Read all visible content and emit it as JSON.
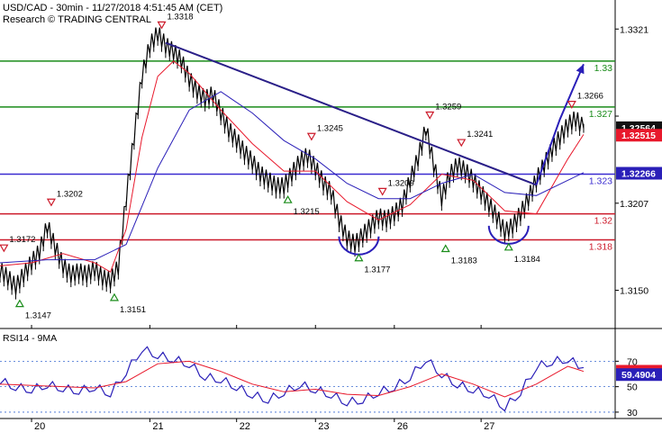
{
  "header": {
    "line1": "USD/CAD - 30min - 11/27/2018 4:51:45 AM (CET)",
    "line2": "Research © TRADING CENTRAL"
  },
  "chart_data": [
    {
      "type": "line",
      "title": "USD/CAD - 30min",
      "ylim": [
        1.3125,
        1.334
      ],
      "x_dates": [
        "20",
        "21",
        "22",
        "23",
        "26",
        "27"
      ],
      "price_ticks": [
        1.3321,
        1.3264,
        1.3207,
        1.315
      ],
      "price_tick_labels": [
        "1.3321",
        "",
        "1.3207",
        "1.3150"
      ],
      "hlines": [
        {
          "label": "1.33",
          "value": 1.33,
          "color": "#1a8c1a"
        },
        {
          "label": "1.327",
          "value": 1.327,
          "color": "#1a8c1a"
        },
        {
          "label": "1.323",
          "value": 1.3226,
          "color": "#3a2bd0"
        },
        {
          "label": "1.32",
          "value": 1.32,
          "color": "#cc1a2a"
        },
        {
          "label": "1.318",
          "value": 1.3183,
          "color": "#cc1a2a"
        }
      ],
      "last_price": {
        "label": "1.32564",
        "value": 1.32564,
        "color": "#111111"
      },
      "ma_fast": {
        "label": "1.32515",
        "value": 1.32515,
        "color": "#e8192c"
      },
      "ma_slow": {
        "label": "1.32266",
        "value": 1.32266,
        "color": "#2a1fb8"
      },
      "pivots": [
        {
          "label": "1.3172",
          "x": 0.5,
          "value": 1.3172,
          "kind": "high"
        },
        {
          "label": "1.3147",
          "x": 2.5,
          "value": 1.3147,
          "kind": "low"
        },
        {
          "label": "1.3202",
          "x": 6.5,
          "value": 1.3202,
          "kind": "high"
        },
        {
          "label": "1.3151",
          "x": 14.5,
          "value": 1.3151,
          "kind": "low"
        },
        {
          "label": "1.3318",
          "x": 20.5,
          "value": 1.3318,
          "kind": "high"
        },
        {
          "label": "1.3215",
          "x": 36.5,
          "value": 1.3215,
          "kind": "low"
        },
        {
          "label": "1.3245",
          "x": 39.5,
          "value": 1.3245,
          "kind": "high"
        },
        {
          "label": "1.3177",
          "x": 45.5,
          "value": 1.3177,
          "kind": "low"
        },
        {
          "label": "1.3209",
          "x": 48.5,
          "value": 1.3209,
          "kind": "high"
        },
        {
          "label": "1.3259",
          "x": 54.5,
          "value": 1.3259,
          "kind": "high"
        },
        {
          "label": "1.3183",
          "x": 56.5,
          "value": 1.3183,
          "kind": "low"
        },
        {
          "label": "1.3241",
          "x": 58.5,
          "value": 1.3241,
          "kind": "high"
        },
        {
          "label": "1.3184",
          "x": 64.5,
          "value": 1.3184,
          "kind": "low"
        },
        {
          "label": "1.3266",
          "x": 72.5,
          "value": 1.3266,
          "kind": "high"
        }
      ],
      "series": [
        {
          "name": "",
          "color": "#000000",
          "x": [
            0,
            1,
            2,
            3,
            4,
            5,
            6,
            7,
            8,
            9,
            10,
            11,
            12,
            13,
            14,
            15,
            16,
            17,
            18,
            19,
            20,
            21,
            22,
            23,
            24,
            25,
            26,
            27,
            28,
            29,
            30,
            31,
            32,
            33,
            34,
            35,
            36,
            37,
            38,
            39,
            40,
            41,
            42,
            43,
            44,
            45,
            46,
            47,
            48,
            49,
            50,
            51,
            52,
            53,
            54,
            55,
            56,
            57,
            58,
            59,
            60,
            61,
            62,
            63,
            64,
            65,
            66,
            67,
            68,
            69,
            70,
            71,
            72,
            73,
            74
          ],
          "values": [
            1.3163,
            1.3158,
            1.3152,
            1.316,
            1.3168,
            1.3175,
            1.3192,
            1.3178,
            1.3166,
            1.316,
            1.3162,
            1.316,
            1.3164,
            1.3158,
            1.3156,
            1.3165,
            1.321,
            1.325,
            1.329,
            1.331,
            1.3318,
            1.331,
            1.3306,
            1.33,
            1.3288,
            1.328,
            1.3275,
            1.3278,
            1.3266,
            1.3255,
            1.3248,
            1.324,
            1.3234,
            1.3226,
            1.3222,
            1.3218,
            1.3218,
            1.3226,
            1.3234,
            1.3238,
            1.323,
            1.322,
            1.3214,
            1.3196,
            1.3184,
            1.318,
            1.3186,
            1.3192,
            1.3198,
            1.3196,
            1.32,
            1.3206,
            1.3222,
            1.3236,
            1.3256,
            1.3232,
            1.321,
            1.3225,
            1.3232,
            1.3228,
            1.3222,
            1.3214,
            1.3206,
            1.3198,
            1.3188,
            1.3192,
            1.32,
            1.321,
            1.3222,
            1.3232,
            1.3242,
            1.325,
            1.3258,
            1.3262,
            1.3256
          ]
        },
        {
          "name": "",
          "color": "#e8192c",
          "x": [
            0,
            4,
            8,
            12,
            14,
            16,
            18,
            20,
            22,
            24,
            28,
            32,
            36,
            40,
            44,
            48,
            52,
            56,
            60,
            64,
            68,
            72,
            74
          ],
          "values": [
            1.3166,
            1.3168,
            1.3174,
            1.3168,
            1.3162,
            1.319,
            1.325,
            1.329,
            1.33,
            1.3292,
            1.3268,
            1.3246,
            1.3228,
            1.3228,
            1.3208,
            1.3196,
            1.3206,
            1.3226,
            1.3222,
            1.3202,
            1.32,
            1.3236,
            1.3252
          ]
        },
        {
          "name": "",
          "color": "#2a1fb8",
          "x": [
            0,
            6,
            12,
            16,
            20,
            24,
            28,
            32,
            36,
            40,
            44,
            48,
            52,
            56,
            60,
            64,
            68,
            72,
            74
          ],
          "values": [
            1.3168,
            1.317,
            1.317,
            1.318,
            1.323,
            1.3268,
            1.328,
            1.3266,
            1.3248,
            1.3236,
            1.322,
            1.321,
            1.321,
            1.322,
            1.3226,
            1.3214,
            1.3212,
            1.3222,
            1.3227
          ]
        }
      ],
      "trendline": {
        "x": [
          21,
          68
        ],
        "values": [
          1.3312,
          1.3219
        ],
        "color": "#2a1f88"
      },
      "projection": {
        "x": [
          68,
          71,
          74
        ],
        "values": [
          1.3219,
          1.3262,
          1.3298
        ],
        "color": "#2a1fb8"
      }
    },
    {
      "type": "line",
      "title": "RSI14 - 9MA",
      "ylim": [
        25,
        95
      ],
      "ticks": [
        70,
        50,
        30
      ],
      "last_rsi": {
        "label": "62.1323",
        "value": 62.1323,
        "color": "#e8192c"
      },
      "last_ma": {
        "label": "59.4904",
        "value": 59.4904,
        "color": "#2a1fb8"
      },
      "series": [
        {
          "name": "RSI14",
          "color": "#2a1fb8",
          "x": [
            0,
            2,
            4,
            6,
            8,
            10,
            12,
            14,
            16,
            18,
            20,
            22,
            24,
            26,
            28,
            30,
            32,
            34,
            36,
            38,
            40,
            42,
            44,
            46,
            48,
            50,
            52,
            54,
            56,
            58,
            60,
            62,
            64,
            66,
            68,
            70,
            72,
            74
          ],
          "values": [
            55,
            50,
            48,
            52,
            49,
            47,
            50,
            45,
            62,
            80,
            75,
            72,
            68,
            58,
            56,
            50,
            44,
            40,
            46,
            52,
            48,
            44,
            38,
            40,
            46,
            50,
            58,
            72,
            60,
            52,
            48,
            44,
            34,
            46,
            66,
            70,
            72,
            65
          ]
        },
        {
          "name": "9MA",
          "color": "#e8192c",
          "x": [
            0,
            4,
            8,
            12,
            16,
            20,
            24,
            28,
            32,
            36,
            40,
            44,
            48,
            52,
            56,
            60,
            64,
            68,
            72,
            74
          ],
          "values": [
            52,
            51,
            50,
            49,
            54,
            68,
            70,
            62,
            52,
            46,
            48,
            44,
            43,
            50,
            60,
            52,
            42,
            52,
            66,
            62
          ]
        }
      ]
    }
  ]
}
